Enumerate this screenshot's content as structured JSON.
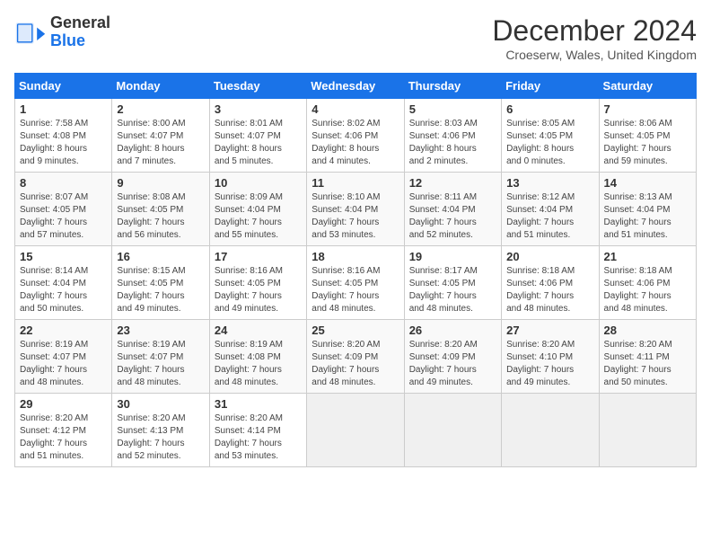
{
  "logo": {
    "line1": "General",
    "line2": "Blue"
  },
  "title": "December 2024",
  "subtitle": "Croeserw, Wales, United Kingdom",
  "days_of_week": [
    "Sunday",
    "Monday",
    "Tuesday",
    "Wednesday",
    "Thursday",
    "Friday",
    "Saturday"
  ],
  "weeks": [
    [
      {
        "day": "1",
        "detail": "Sunrise: 7:58 AM\nSunset: 4:08 PM\nDaylight: 8 hours\nand 9 minutes."
      },
      {
        "day": "2",
        "detail": "Sunrise: 8:00 AM\nSunset: 4:07 PM\nDaylight: 8 hours\nand 7 minutes."
      },
      {
        "day": "3",
        "detail": "Sunrise: 8:01 AM\nSunset: 4:07 PM\nDaylight: 8 hours\nand 5 minutes."
      },
      {
        "day": "4",
        "detail": "Sunrise: 8:02 AM\nSunset: 4:06 PM\nDaylight: 8 hours\nand 4 minutes."
      },
      {
        "day": "5",
        "detail": "Sunrise: 8:03 AM\nSunset: 4:06 PM\nDaylight: 8 hours\nand 2 minutes."
      },
      {
        "day": "6",
        "detail": "Sunrise: 8:05 AM\nSunset: 4:05 PM\nDaylight: 8 hours\nand 0 minutes."
      },
      {
        "day": "7",
        "detail": "Sunrise: 8:06 AM\nSunset: 4:05 PM\nDaylight: 7 hours\nand 59 minutes."
      }
    ],
    [
      {
        "day": "8",
        "detail": "Sunrise: 8:07 AM\nSunset: 4:05 PM\nDaylight: 7 hours\nand 57 minutes."
      },
      {
        "day": "9",
        "detail": "Sunrise: 8:08 AM\nSunset: 4:05 PM\nDaylight: 7 hours\nand 56 minutes."
      },
      {
        "day": "10",
        "detail": "Sunrise: 8:09 AM\nSunset: 4:04 PM\nDaylight: 7 hours\nand 55 minutes."
      },
      {
        "day": "11",
        "detail": "Sunrise: 8:10 AM\nSunset: 4:04 PM\nDaylight: 7 hours\nand 53 minutes."
      },
      {
        "day": "12",
        "detail": "Sunrise: 8:11 AM\nSunset: 4:04 PM\nDaylight: 7 hours\nand 52 minutes."
      },
      {
        "day": "13",
        "detail": "Sunrise: 8:12 AM\nSunset: 4:04 PM\nDaylight: 7 hours\nand 51 minutes."
      },
      {
        "day": "14",
        "detail": "Sunrise: 8:13 AM\nSunset: 4:04 PM\nDaylight: 7 hours\nand 51 minutes."
      }
    ],
    [
      {
        "day": "15",
        "detail": "Sunrise: 8:14 AM\nSunset: 4:04 PM\nDaylight: 7 hours\nand 50 minutes."
      },
      {
        "day": "16",
        "detail": "Sunrise: 8:15 AM\nSunset: 4:05 PM\nDaylight: 7 hours\nand 49 minutes."
      },
      {
        "day": "17",
        "detail": "Sunrise: 8:16 AM\nSunset: 4:05 PM\nDaylight: 7 hours\nand 49 minutes."
      },
      {
        "day": "18",
        "detail": "Sunrise: 8:16 AM\nSunset: 4:05 PM\nDaylight: 7 hours\nand 48 minutes."
      },
      {
        "day": "19",
        "detail": "Sunrise: 8:17 AM\nSunset: 4:05 PM\nDaylight: 7 hours\nand 48 minutes."
      },
      {
        "day": "20",
        "detail": "Sunrise: 8:18 AM\nSunset: 4:06 PM\nDaylight: 7 hours\nand 48 minutes."
      },
      {
        "day": "21",
        "detail": "Sunrise: 8:18 AM\nSunset: 4:06 PM\nDaylight: 7 hours\nand 48 minutes."
      }
    ],
    [
      {
        "day": "22",
        "detail": "Sunrise: 8:19 AM\nSunset: 4:07 PM\nDaylight: 7 hours\nand 48 minutes."
      },
      {
        "day": "23",
        "detail": "Sunrise: 8:19 AM\nSunset: 4:07 PM\nDaylight: 7 hours\nand 48 minutes."
      },
      {
        "day": "24",
        "detail": "Sunrise: 8:19 AM\nSunset: 4:08 PM\nDaylight: 7 hours\nand 48 minutes."
      },
      {
        "day": "25",
        "detail": "Sunrise: 8:20 AM\nSunset: 4:09 PM\nDaylight: 7 hours\nand 48 minutes."
      },
      {
        "day": "26",
        "detail": "Sunrise: 8:20 AM\nSunset: 4:09 PM\nDaylight: 7 hours\nand 49 minutes."
      },
      {
        "day": "27",
        "detail": "Sunrise: 8:20 AM\nSunset: 4:10 PM\nDaylight: 7 hours\nand 49 minutes."
      },
      {
        "day": "28",
        "detail": "Sunrise: 8:20 AM\nSunset: 4:11 PM\nDaylight: 7 hours\nand 50 minutes."
      }
    ],
    [
      {
        "day": "29",
        "detail": "Sunrise: 8:20 AM\nSunset: 4:12 PM\nDaylight: 7 hours\nand 51 minutes."
      },
      {
        "day": "30",
        "detail": "Sunrise: 8:20 AM\nSunset: 4:13 PM\nDaylight: 7 hours\nand 52 minutes."
      },
      {
        "day": "31",
        "detail": "Sunrise: 8:20 AM\nSunset: 4:14 PM\nDaylight: 7 hours\nand 53 minutes."
      },
      {
        "day": "",
        "detail": ""
      },
      {
        "day": "",
        "detail": ""
      },
      {
        "day": "",
        "detail": ""
      },
      {
        "day": "",
        "detail": ""
      }
    ]
  ]
}
